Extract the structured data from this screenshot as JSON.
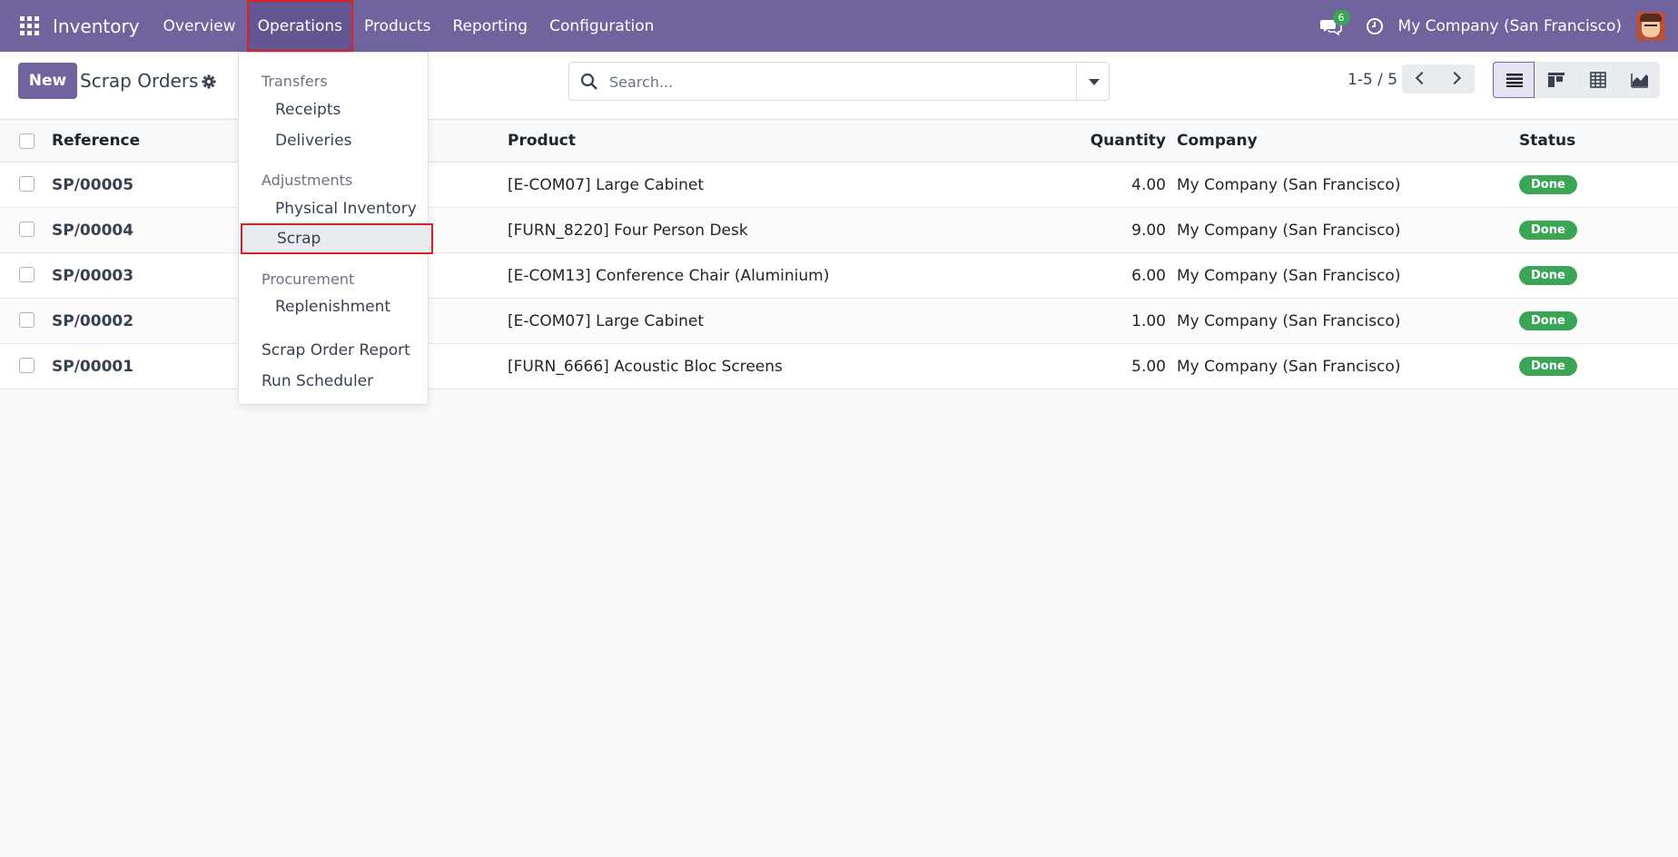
{
  "navbar": {
    "app_name": "Inventory",
    "menu": [
      "Overview",
      "Operations",
      "Products",
      "Reporting",
      "Configuration"
    ],
    "active_menu": "Operations",
    "chat_count": "6",
    "company": "My Company (San Francisco)",
    "icons": [
      "apps-grid-icon",
      "chat-icon",
      "clock-icon",
      "avatar"
    ],
    "accent_color": "#71639e"
  },
  "control_panel": {
    "new_label": "New",
    "title": "Scrap Orders",
    "search_placeholder": "Search...",
    "pager": "1-5 / 5",
    "views": [
      "list-view-icon",
      "kanban-view-icon",
      "pivot-view-icon",
      "graph-view-icon"
    ],
    "active_view": "list"
  },
  "table": {
    "columns": {
      "reference": "Reference",
      "product": "Product",
      "quantity": "Quantity",
      "company": "Company",
      "status": "Status"
    },
    "rows": [
      {
        "reference": "SP/00005",
        "product": "[E-COM07] Large Cabinet",
        "quantity": "4.00",
        "company": "My Company (San Francisco)",
        "status": "Done"
      },
      {
        "reference": "SP/00004",
        "product": "[FURN_8220] Four Person Desk",
        "quantity": "9.00",
        "company": "My Company (San Francisco)",
        "status": "Done"
      },
      {
        "reference": "SP/00003",
        "product": "[E-COM13] Conference Chair (Aluminium)",
        "quantity": "6.00",
        "company": "My Company (San Francisco)",
        "status": "Done"
      },
      {
        "reference": "SP/00002",
        "product": "[E-COM07] Large Cabinet",
        "quantity": "1.00",
        "company": "My Company (San Francisco)",
        "status": "Done"
      },
      {
        "reference": "SP/00001",
        "product": "[FURN_6666] Acoustic Bloc Screens",
        "quantity": "5.00",
        "company": "My Company (San Francisco)",
        "status": "Done"
      }
    ],
    "status_color": "#3aa655"
  },
  "dropdown": {
    "sections": {
      "transfers": "Transfers",
      "adjustments": "Adjustments",
      "procurement": "Procurement"
    },
    "items": {
      "receipts": "Receipts",
      "deliveries": "Deliveries",
      "physical_inventory": "Physical Inventory",
      "scrap": "Scrap",
      "replenishment": "Replenishment",
      "scrap_order_report": "Scrap Order Report",
      "run_scheduler": "Run Scheduler"
    },
    "highlighted": "Scrap"
  }
}
